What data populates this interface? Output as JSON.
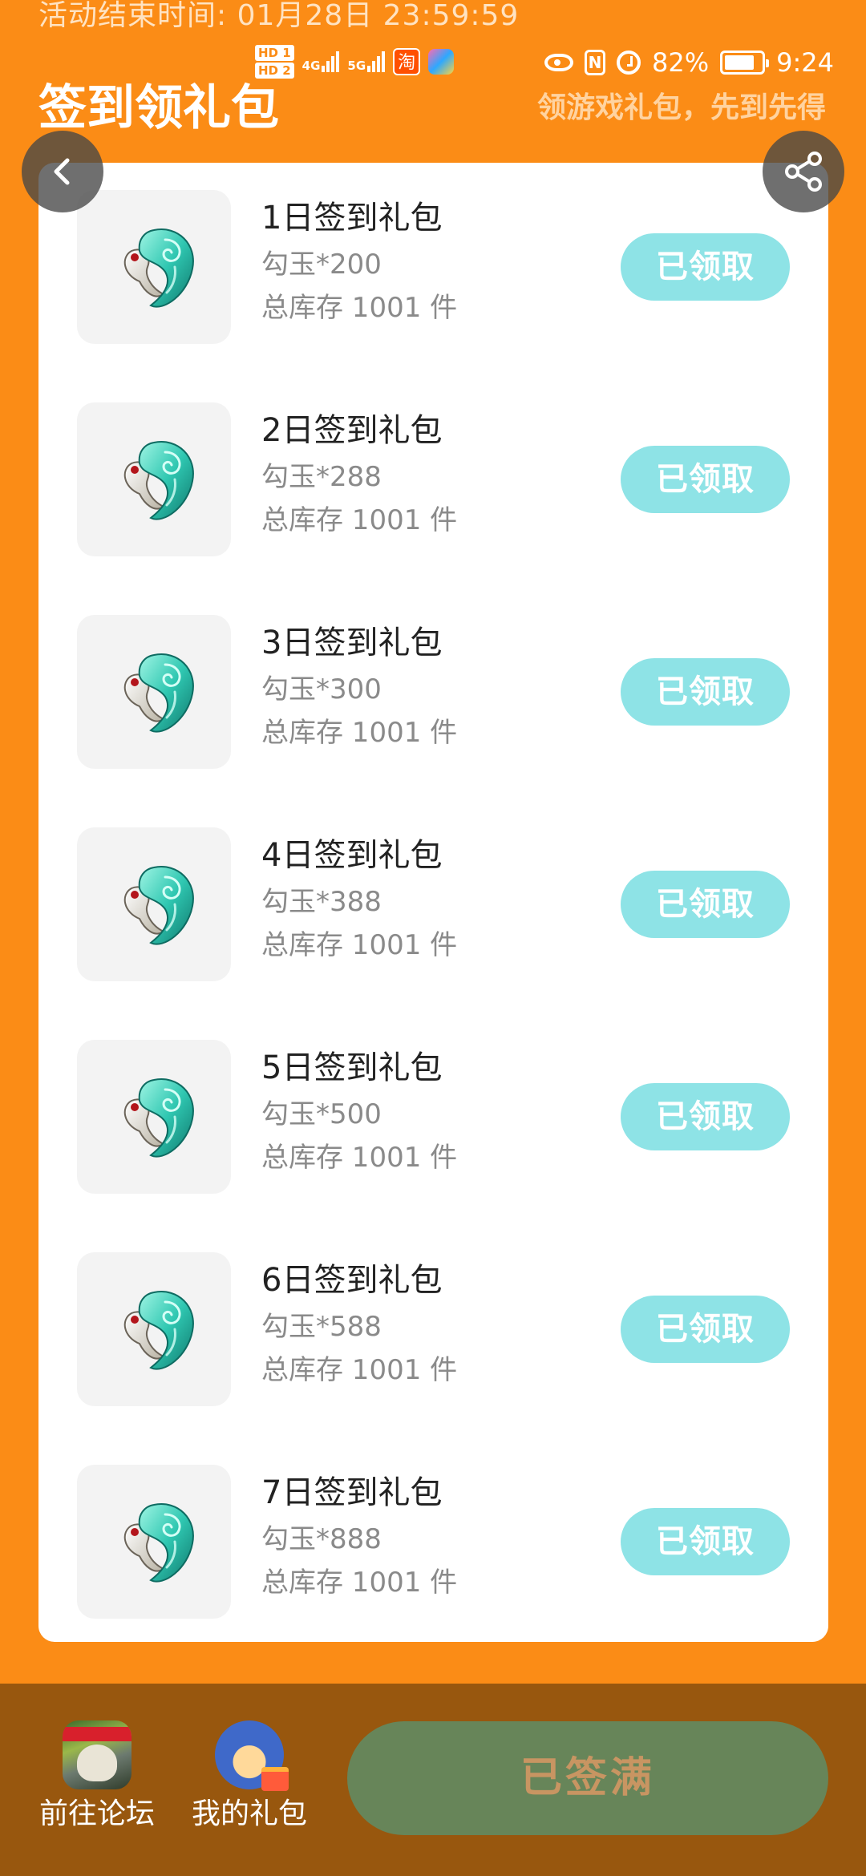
{
  "status_bar": {
    "activity_end_text": "活动结束时间: 01月28日 23:59:59",
    "hd1": "HD 1",
    "hd2": "HD 2",
    "net1": "4G",
    "net2": "5G",
    "taobao_glyph": "淘",
    "nfc": "N",
    "battery": "82%",
    "battery_level": 0.82,
    "time": "9:24"
  },
  "header": {
    "title": "签到领礼包",
    "slogan": "领游戏礼包，先到先得"
  },
  "gifts": [
    {
      "name": "1日签到礼包",
      "reward": "勾玉*200",
      "stock": "总库存 1001 件",
      "button": "已领取"
    },
    {
      "name": "2日签到礼包",
      "reward": "勾玉*288",
      "stock": "总库存 1001 件",
      "button": "已领取"
    },
    {
      "name": "3日签到礼包",
      "reward": "勾玉*300",
      "stock": "总库存 1001 件",
      "button": "已领取"
    },
    {
      "name": "4日签到礼包",
      "reward": "勾玉*388",
      "stock": "总库存 1001 件",
      "button": "已领取"
    },
    {
      "name": "5日签到礼包",
      "reward": "勾玉*500",
      "stock": "总库存 1001 件",
      "button": "已领取"
    },
    {
      "name": "6日签到礼包",
      "reward": "勾玉*588",
      "stock": "总库存 1001 件",
      "button": "已领取"
    },
    {
      "name": "7日签到礼包",
      "reward": "勾玉*888",
      "stock": "总库存 1001 件",
      "button": "已领取"
    }
  ],
  "bottom": {
    "forum_label": "前往论坛",
    "mygifts_label": "我的礼包",
    "main_button": "已签满"
  }
}
